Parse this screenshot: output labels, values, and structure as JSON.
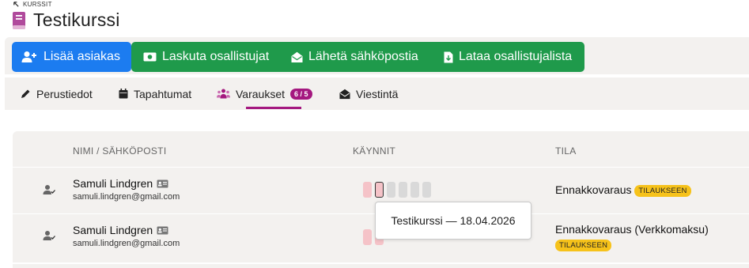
{
  "breadcrumb": {
    "label": "KURSSIT"
  },
  "page": {
    "title": "Testikurssi"
  },
  "toolbar": {
    "add_customer": "Lisää asiakas",
    "invoice_participants": "Laskuta osallistujat",
    "send_email": "Lähetä sähköpostia",
    "download_list": "Lataa osallistujalista"
  },
  "tabs": [
    {
      "label": "Perustiedot",
      "icon": "pencil-icon"
    },
    {
      "label": "Tapahtumat",
      "icon": "calendar-icon"
    },
    {
      "label": "Varaukset",
      "icon": "users-icon",
      "badge": "6 / 5",
      "active": true
    },
    {
      "label": "Viestintä",
      "icon": "envelope-open-icon"
    }
  ],
  "table": {
    "headers": [
      "NIMI / SÄHKÖPOSTI",
      "KÄYNNIT",
      "TILA"
    ],
    "rows": [
      {
        "name": "Samuli Lindgren",
        "email": "samuli.lindgren@gmail.com",
        "status": "Ennakkovaraus",
        "tag": "TILAUKSEEN"
      },
      {
        "name": "Samuli Lindgren",
        "email": "samuli.lindgren@gmail.com",
        "status": "Ennakkovaraus (Verkkomaksu)",
        "tag": "TILAUKSEEN"
      }
    ]
  },
  "tooltip": {
    "text": "Testikurssi — 18.04.2026"
  },
  "colors": {
    "primary_blue": "#1c7cf0",
    "action_green": "#1f9a4b",
    "accent_magenta": "#a4187f",
    "tag_yellow": "#f6c21a",
    "visit_pink": "#f5c3c8"
  }
}
